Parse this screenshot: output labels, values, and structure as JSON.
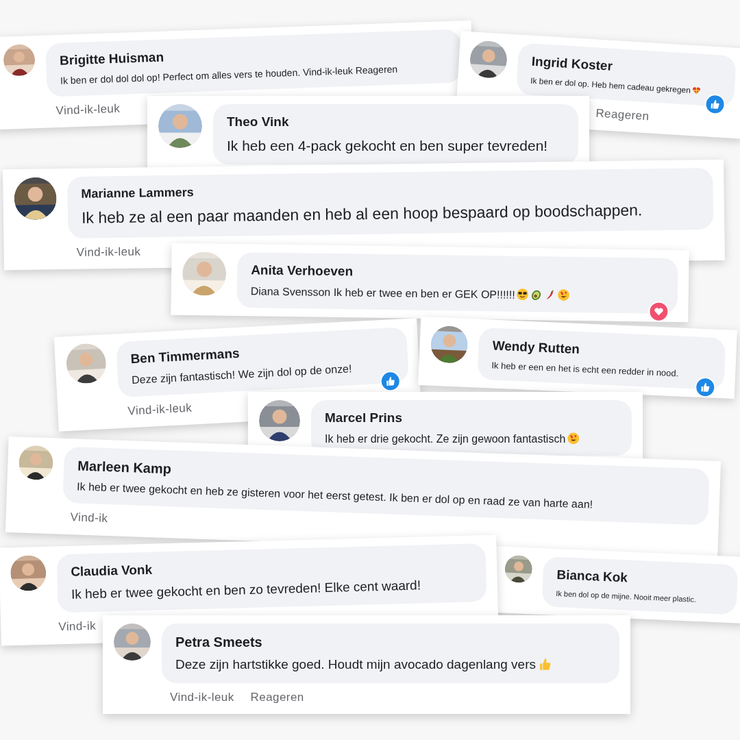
{
  "comments": [
    {
      "name": "Brigitte Huisman",
      "text": "Ik ben er dol dol dol op! Perfect om alles vers te houden. Vind-ik-leuk Reageren",
      "actions": [
        "Vind-ik-leuk"
      ]
    },
    {
      "name": "Ingrid Koster",
      "text": "Ik ben er dol op. Heb hem cadeau gekregen",
      "icons": [
        {
          "kind": "gift-heart"
        }
      ],
      "actions": [
        "Reageren"
      ],
      "badge": {
        "kind": "like"
      }
    },
    {
      "name": "Theo Vink",
      "text": "Ik heb een 4-pack gekocht en ben super tevreden!"
    },
    {
      "name": "Marianne Lammers",
      "text": "Ik heb ze al een paar maanden en heb al een hoop bespaard op boodschappen.",
      "actions": [
        "Vind-ik-leuk"
      ]
    },
    {
      "name": "Anita Verhoeven",
      "text": "Diana Svensson Ik heb er twee en ben er GEK OP!!!!!!",
      "icons": [
        {
          "kind": "sunglasses-face"
        },
        {
          "kind": "avocado"
        },
        {
          "kind": "chili"
        },
        {
          "kind": "heart-eyes"
        }
      ],
      "badge": {
        "kind": "love"
      }
    },
    {
      "name": "Ben Timmermans",
      "text": "Deze zijn fantastisch! We zijn dol op de onze!",
      "actions": [
        "Vind-ik-leuk"
      ],
      "badge": {
        "kind": "like"
      }
    },
    {
      "name": "Wendy Rutten",
      "text": "Ik heb er een en het is echt een redder in nood.",
      "badge": {
        "kind": "like"
      }
    },
    {
      "name": "Marcel Prins",
      "text": "Ik heb er drie gekocht. Ze zijn gewoon fantastisch",
      "icons": [
        {
          "kind": "heart-eyes"
        }
      ]
    },
    {
      "name": "Marleen Kamp",
      "text": "Ik heb er twee gekocht en heb ze gisteren voor het eerst getest. Ik ben er dol op en raad ze van harte aan!",
      "actions": [
        "Vind-ik"
      ]
    },
    {
      "name": "Bianca Kok",
      "text": "Ik ben dol op de mijne. Nooit meer plastic."
    },
    {
      "name": "Claudia Vonk",
      "text": "Ik heb er twee gekocht en ben zo tevreden! Elke cent waard!",
      "actions": [
        "Vind-ik"
      ]
    },
    {
      "name": "Petra Smeets",
      "text": "Deze zijn hartstikke goed. Houdt mijn avocado dagenlang vers",
      "icons": [
        {
          "kind": "thumbs-up"
        }
      ],
      "actions": [
        "Vind-ik-leuk",
        "Reageren"
      ]
    }
  ]
}
